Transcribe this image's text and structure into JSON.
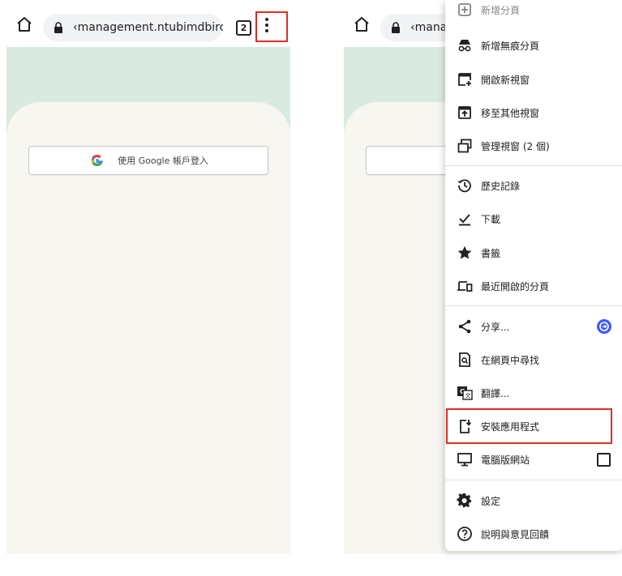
{
  "left_panel": {
    "url_text": "‹management.ntubimdbirc.tw",
    "tab_count": "2",
    "google_signin_label": "使用 Google 帳戶登入"
  },
  "right_panel": {
    "url_text": "‹manag",
    "menu": {
      "items": [
        {
          "label": "新增分頁",
          "icon": "new-tab-icon"
        },
        {
          "label": "新增無痕分頁",
          "icon": "incognito-icon"
        },
        {
          "label": "開啟新視窗",
          "icon": "new-window-icon"
        },
        {
          "label": "移至其他視窗",
          "icon": "move-window-icon"
        },
        {
          "label": "管理視窗 (2 個)",
          "icon": "manage-windows-icon"
        },
        {
          "label": "歷史記錄",
          "icon": "history-icon"
        },
        {
          "label": "下載",
          "icon": "download-icon"
        },
        {
          "label": "書籤",
          "icon": "star-icon"
        },
        {
          "label": "最近開啟的分頁",
          "icon": "recent-tabs-icon"
        },
        {
          "label": "分享...",
          "icon": "share-icon"
        },
        {
          "label": "在網頁中尋找",
          "icon": "find-in-page-icon"
        },
        {
          "label": "翻譯...",
          "icon": "translate-icon"
        },
        {
          "label": "安裝應用程式",
          "icon": "install-app-icon"
        },
        {
          "label": "電腦版網站",
          "icon": "desktop-icon"
        },
        {
          "label": "設定",
          "icon": "gear-icon"
        },
        {
          "label": "說明與意見回饋",
          "icon": "help-icon"
        }
      ]
    }
  },
  "colors": {
    "header_mint": "#d9ebe1",
    "card_bg": "#f8f6f0",
    "highlight_red": "#d93025",
    "share_badge": "#3d5afe"
  }
}
